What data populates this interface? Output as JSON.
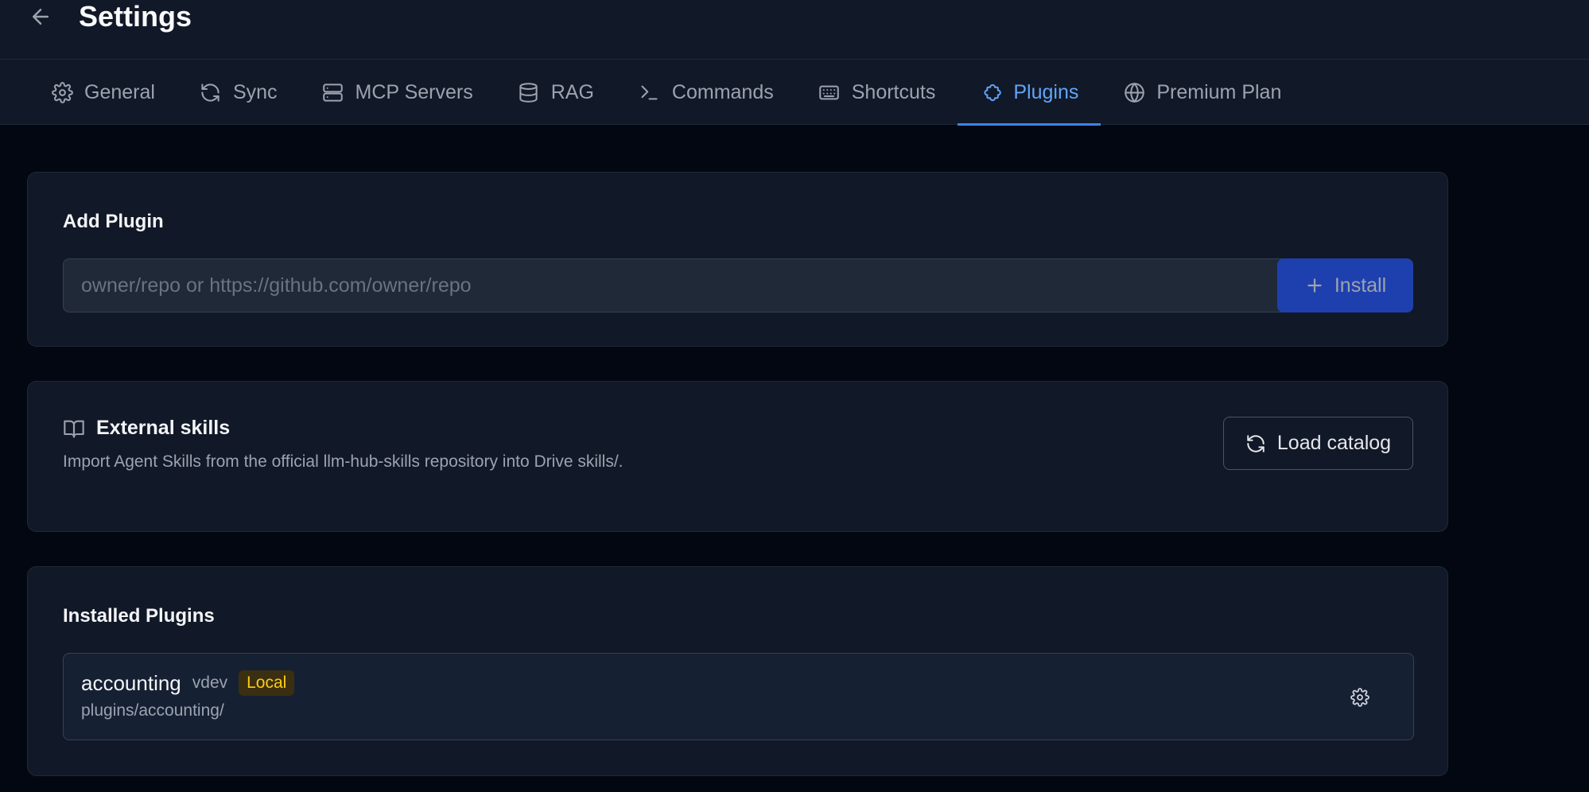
{
  "header": {
    "title": "Settings",
    "back_icon": "arrow-left-icon"
  },
  "tabs": [
    {
      "label": "General",
      "icon": "gear-icon",
      "active": false
    },
    {
      "label": "Sync",
      "icon": "refresh-icon",
      "active": false
    },
    {
      "label": "MCP Servers",
      "icon": "server-icon",
      "active": false
    },
    {
      "label": "RAG",
      "icon": "database-icon",
      "active": false
    },
    {
      "label": "Commands",
      "icon": "terminal-icon",
      "active": false
    },
    {
      "label": "Shortcuts",
      "icon": "keyboard-icon",
      "active": false
    },
    {
      "label": "Plugins",
      "icon": "puzzle-icon",
      "active": true
    },
    {
      "label": "Premium Plan",
      "icon": "globe-icon",
      "active": false
    }
  ],
  "add_plugin": {
    "title": "Add Plugin",
    "input_value": "",
    "input_placeholder": "owner/repo or https://github.com/owner/repo",
    "install_label": "Install"
  },
  "external_skills": {
    "title": "External skills",
    "description": "Import Agent Skills from the official llm-hub-skills repository into Drive skills/.",
    "load_label": "Load catalog"
  },
  "installed": {
    "title": "Installed Plugins",
    "plugins": [
      {
        "name": "accounting",
        "version": "vdev",
        "badge": "Local",
        "path": "plugins/accounting/"
      }
    ]
  },
  "colors": {
    "background": "#030712",
    "panel": "#111827",
    "accent": "#60a5fa",
    "install_button": "#1e40af",
    "badge_text": "#facc15"
  }
}
